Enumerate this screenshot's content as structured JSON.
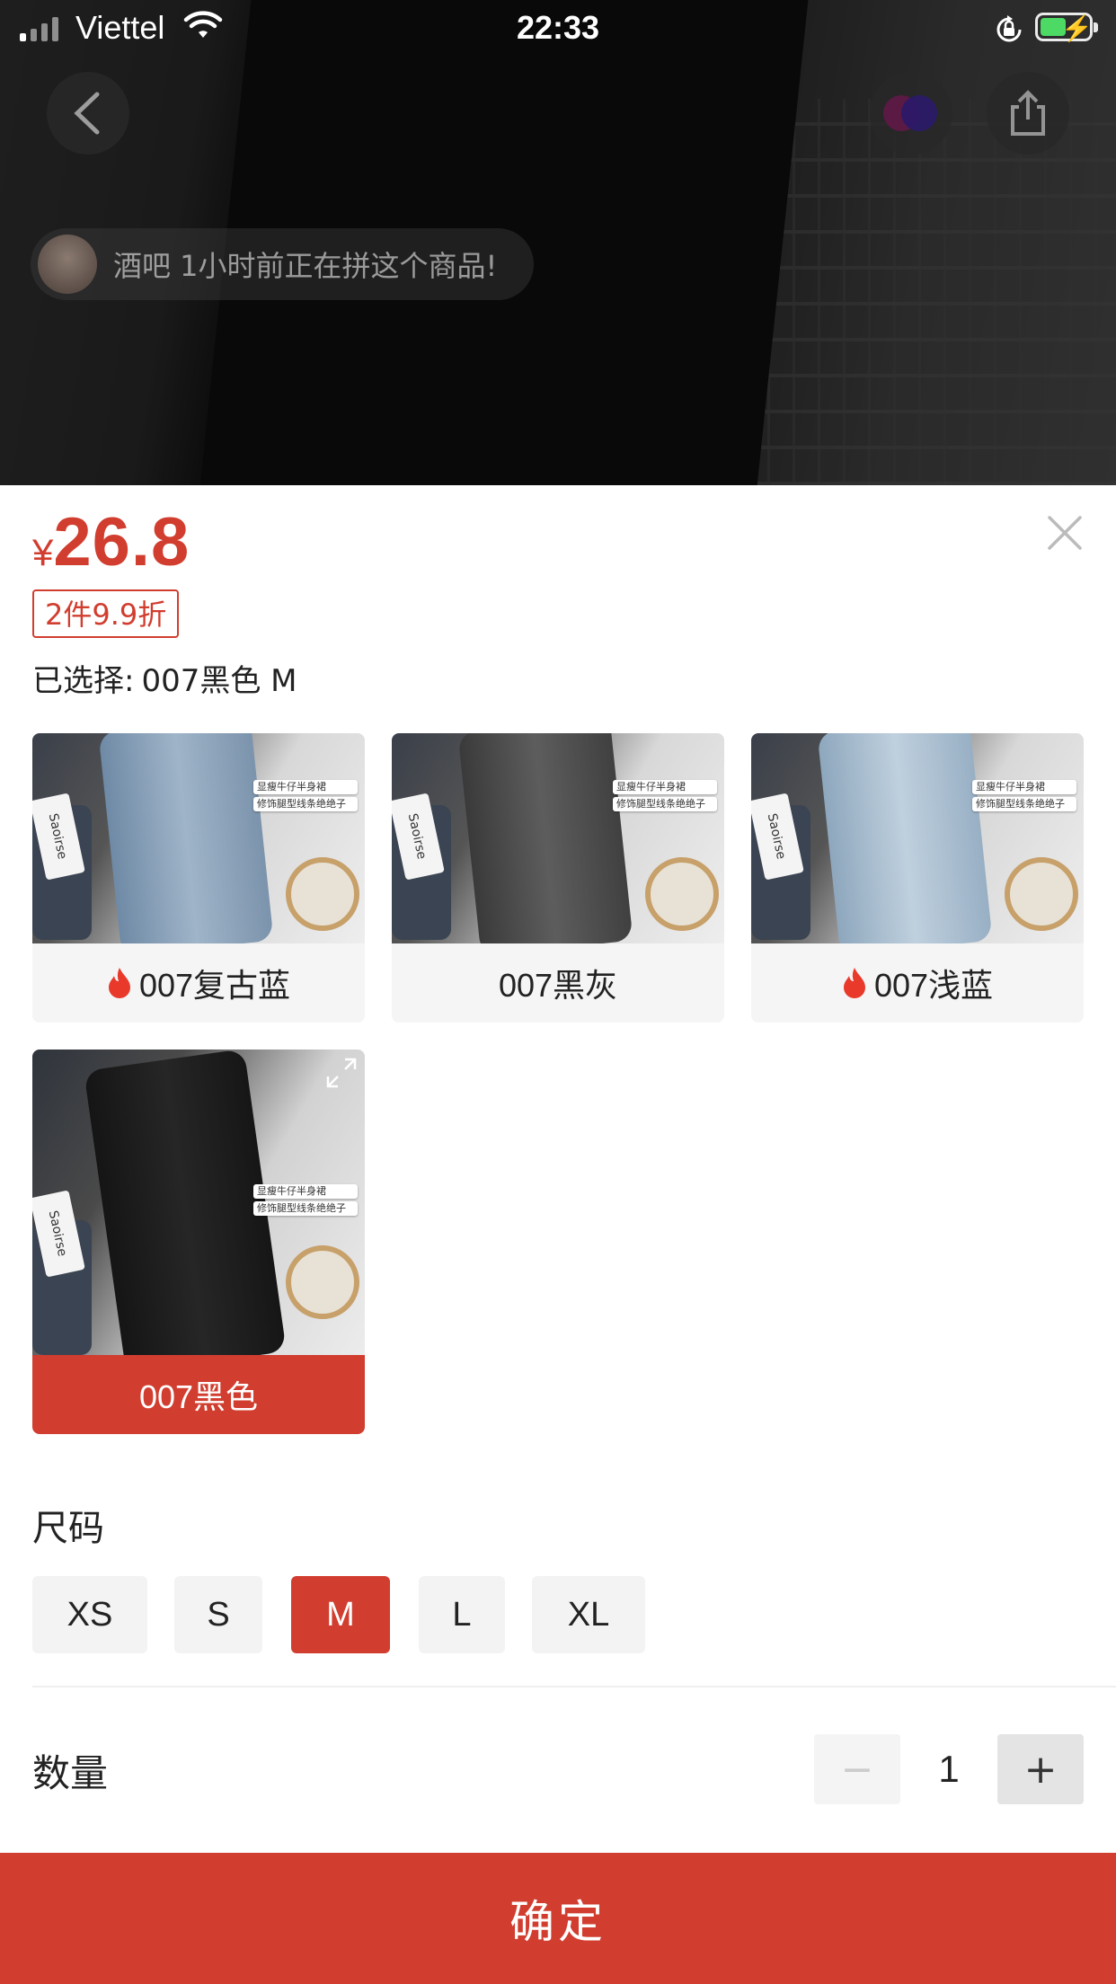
{
  "status_bar": {
    "carrier": "Viettel",
    "time": "22:33"
  },
  "header": {
    "ticker_text": "酒吧 1小时前正在拼这个商品!"
  },
  "product": {
    "currency": "¥",
    "price": "26.8",
    "promo": "2件9.9折",
    "selected_label": "已选择:",
    "selected_value": "007黑色 M"
  },
  "variants": [
    {
      "label": "007复古蓝",
      "hot": true,
      "selected": false
    },
    {
      "label": "007黑灰",
      "hot": false,
      "selected": false
    },
    {
      "label": "007浅蓝",
      "hot": true,
      "selected": false
    },
    {
      "label": "007黑色",
      "hot": false,
      "selected": true
    }
  ],
  "sticker_lines": [
    "显瘦牛仔半身裙",
    "修饰腿型线条绝绝子"
  ],
  "sticker_brand": "Saoirse",
  "size": {
    "title": "尺码",
    "options": [
      "XS",
      "S",
      "M",
      "L",
      "XL"
    ],
    "selected": "M"
  },
  "quantity": {
    "title": "数量",
    "value": "1",
    "minus": "−",
    "plus": "+"
  },
  "confirm_label": "确定",
  "colors": {
    "accent": "#d13d2f",
    "hot_icon": "#e8392b"
  }
}
